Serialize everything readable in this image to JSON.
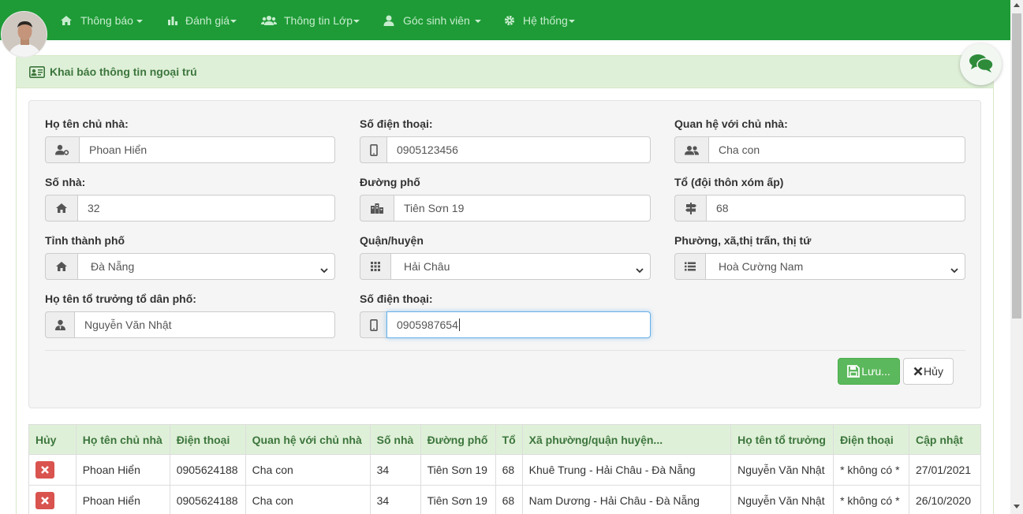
{
  "nav": {
    "items": [
      {
        "label": "Thông báo",
        "icon": "home-icon"
      },
      {
        "label": "Đánh giá",
        "icon": "bar-chart-icon"
      },
      {
        "label": "Thông tin Lớp",
        "icon": "users-icon"
      },
      {
        "label": "Góc sinh viên",
        "icon": "user-icon"
      },
      {
        "label": "Hệ thống",
        "icon": "gear-icon"
      }
    ]
  },
  "panel": {
    "title": "Khai báo thông tin ngoại trú"
  },
  "form": {
    "owner_name_label": "Họ tên chủ nhà:",
    "owner_name_value": "Phoan Hiển",
    "phone_label": "Số điện thoại:",
    "phone_value": "0905123456",
    "relation_label": "Quan hệ với chủ nhà:",
    "relation_value": "Cha con",
    "house_no_label": "Số nhà:",
    "house_no_value": "32",
    "street_label": "Đường phố",
    "street_value": "Tiên Sơn 19",
    "group_label": "Tổ (đội thôn xóm ấp)",
    "group_value": "68",
    "province_label": "Tỉnh thành phố",
    "province_value": "Đà Nẵng",
    "district_label": "Quận/huyện",
    "district_value": "Hải Châu",
    "ward_label": "Phường, xã,thị trấn, thị tứ",
    "ward_value": "Hoà Cường Nam",
    "leader_label": "Họ tên tổ trưởng tổ dân phố:",
    "leader_value": "Nguyễn Văn Nhật",
    "leader_phone_label": "Số điện thoại:",
    "leader_phone_value": "0905987654",
    "save_label": "Lưu...",
    "cancel_label": "Hủy"
  },
  "table": {
    "headers": [
      "Hủy",
      "Họ tên chủ nhà",
      "Điện thoại",
      "Quan hệ với chủ nhà",
      "Số nhà",
      "Đường phố",
      "Tổ",
      "Xã phường/quận huyện...",
      "Họ tên tổ trưởng",
      "Điện thoại",
      "Cập nhật"
    ],
    "rows": [
      [
        "",
        "Phoan Hiển",
        "0905624188",
        "Cha con",
        "34",
        "Tiên Sơn 19",
        "68",
        "Khuê Trung - Hải Châu - Đà Nẵng",
        "Nguyễn Văn Nhật",
        "* không có *",
        "27/01/2021"
      ],
      [
        "",
        "Phoan Hiển",
        "0905624188",
        "Cha con",
        "34",
        "Tiên Sơn 19",
        "68",
        "Nam Dương - Hải Châu - Đà Nẵng",
        "Nguyễn Văn Nhật",
        "* không có *",
        "26/10/2020"
      ]
    ]
  },
  "colors": {
    "brand": "#1e9b36",
    "success": "#5cb85c",
    "danger": "#d9534f",
    "heading_bg": "#dff0d8",
    "heading_text": "#3c763d"
  }
}
